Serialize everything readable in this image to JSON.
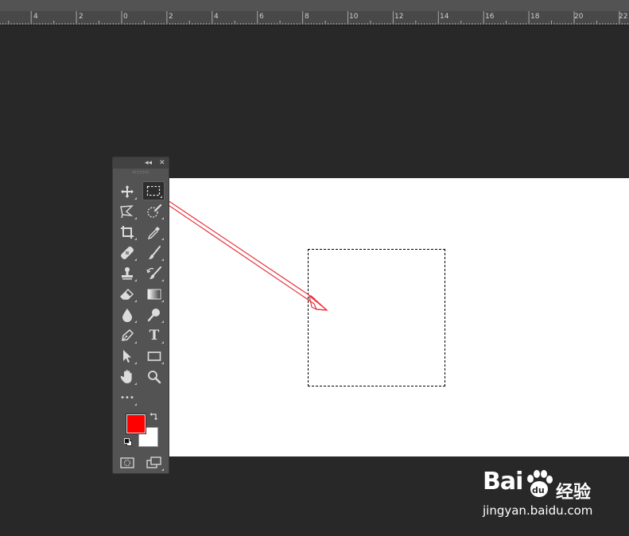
{
  "ruler": {
    "labels": [
      "4",
      "2",
      "0",
      "2",
      "4",
      "6",
      "8",
      "10",
      "12",
      "14",
      "16",
      "18",
      "20",
      "22"
    ]
  },
  "toolbar": {
    "collapse_glyph": "◂◂",
    "close_glyph": "✕",
    "tools": [
      {
        "id": "move-tool",
        "icon": "move-icon"
      },
      {
        "id": "rectangular-marquee-tool",
        "icon": "marquee-icon",
        "active": true
      },
      {
        "id": "lasso-tool",
        "icon": "polygonal-lasso-icon"
      },
      {
        "id": "quick-selection-tool",
        "icon": "quick-selection-icon"
      },
      {
        "id": "crop-tool",
        "icon": "crop-icon"
      },
      {
        "id": "eyedropper-tool",
        "icon": "eyedropper-icon"
      },
      {
        "id": "healing-brush-tool",
        "icon": "bandage-icon"
      },
      {
        "id": "brush-tool",
        "icon": "brush-icon"
      },
      {
        "id": "clone-stamp-tool",
        "icon": "stamp-icon"
      },
      {
        "id": "history-brush-tool",
        "icon": "history-brush-icon"
      },
      {
        "id": "eraser-tool",
        "icon": "eraser-icon"
      },
      {
        "id": "gradient-tool",
        "icon": "gradient-icon"
      },
      {
        "id": "blur-tool",
        "icon": "drop-icon"
      },
      {
        "id": "dodge-tool",
        "icon": "dodge-icon"
      },
      {
        "id": "pen-tool",
        "icon": "pen-icon"
      },
      {
        "id": "type-tool",
        "icon": "type-icon",
        "label": "T"
      },
      {
        "id": "path-selection-tool",
        "icon": "arrow-cursor-icon"
      },
      {
        "id": "rectangle-tool",
        "icon": "rectangle-icon"
      },
      {
        "id": "hand-tool",
        "icon": "hand-icon"
      },
      {
        "id": "zoom-tool",
        "icon": "zoom-icon"
      }
    ],
    "more_glyph": "•••",
    "foreground_color": "#ff0000",
    "background_color": "#ffffff"
  },
  "canvas": {
    "background": "#ffffff"
  },
  "annotation": {
    "arrow_color": "#e8323c"
  },
  "watermark": {
    "brand_bai": "Bai",
    "brand_du": "du",
    "brand_jingyan": "经验",
    "url": "jingyan.baidu.com"
  }
}
